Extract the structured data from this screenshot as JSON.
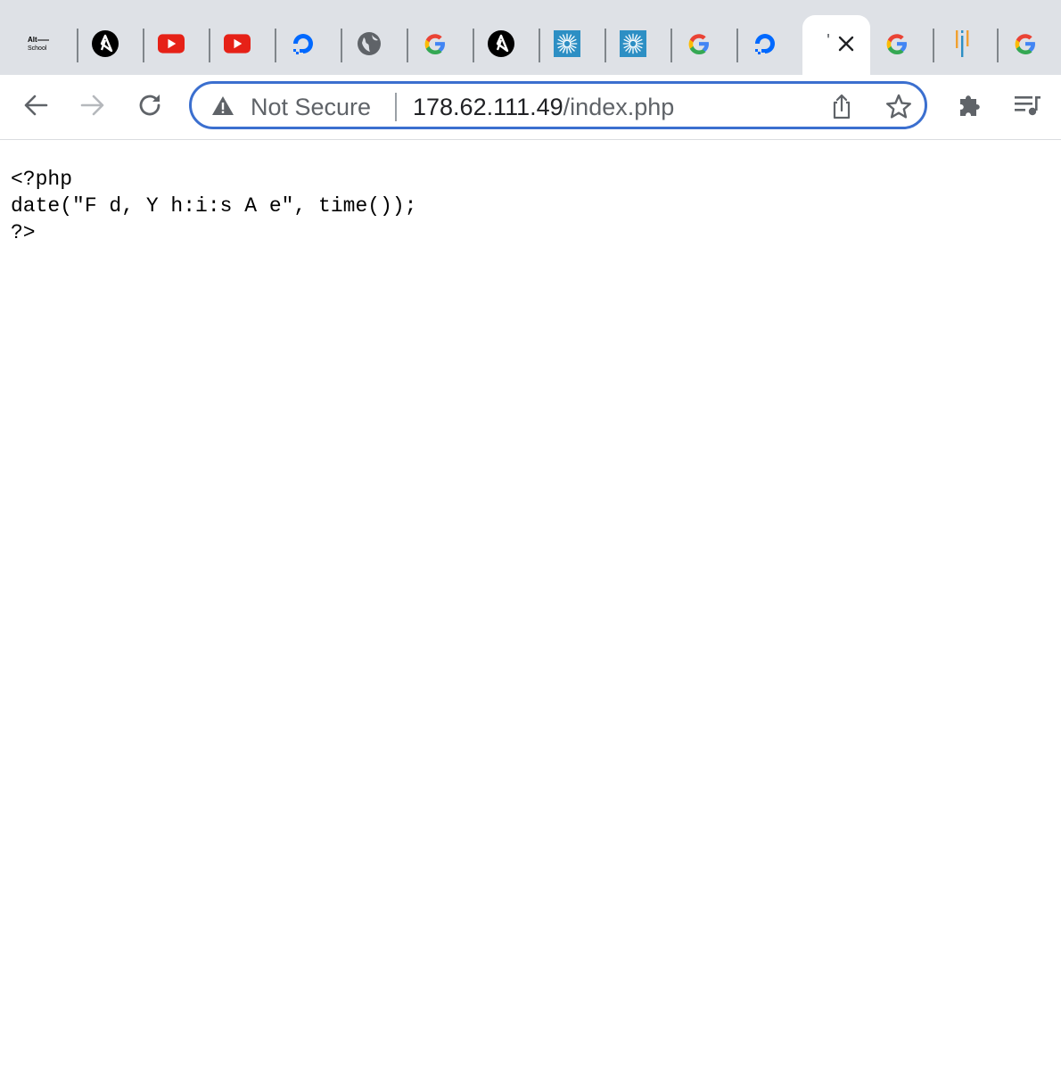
{
  "browser": {
    "tabs": [
      {
        "favicon": "altschool-logo-icon",
        "logo_text_1": "Alt",
        "logo_text_2": "School"
      },
      {
        "favicon": "ansible-icon"
      },
      {
        "favicon": "youtube-icon"
      },
      {
        "favicon": "youtube-icon"
      },
      {
        "favicon": "digitalocean-icon"
      },
      {
        "favicon": "globe-icon"
      },
      {
        "favicon": "google-icon"
      },
      {
        "favicon": "ansible-icon"
      },
      {
        "favicon": "dandelion-icon"
      },
      {
        "favicon": "dandelion-icon"
      },
      {
        "favicon": "google-icon"
      },
      {
        "favicon": "digitalocean-icon"
      },
      {
        "favicon": "blank-page-icon",
        "active": true,
        "glyph": "'"
      },
      {
        "favicon": "google-icon"
      },
      {
        "favicon": "bars-logo-icon"
      },
      {
        "favicon": "google-icon"
      }
    ],
    "omnibox": {
      "security_label": "Not Secure",
      "url_host": "178.62.111.49",
      "url_path": "/index.php"
    },
    "colors": {
      "tabstrip_bg": "#dee1e6",
      "omnibox_border": "#3b6fcf"
    }
  },
  "page": {
    "lines": [
      "<?php",
      "date(\"F d, Y h:i:s A e\", time());",
      "?>"
    ]
  }
}
